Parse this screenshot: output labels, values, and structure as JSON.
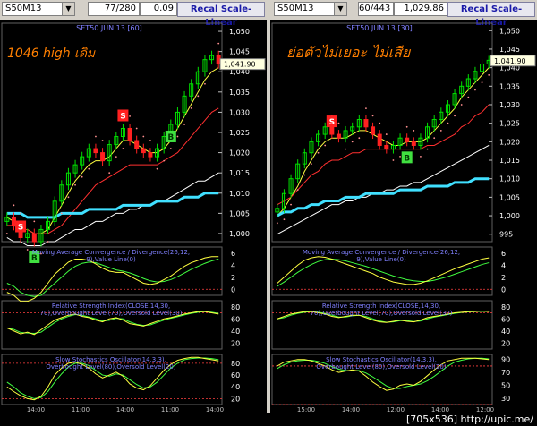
{
  "panels": [
    {
      "symbol": "S50M13",
      "counter": "77/280",
      "value_field": "0.09",
      "recal_label": "Recal Scale-Linear",
      "chart_title": "SET50 JUN 13",
      "interval": "[60]",
      "annotation": "1046 high เดิม",
      "last_price": "1,041.90",
      "price_axis": [
        "1,050",
        "1,045",
        "1,040",
        "1,035",
        "1,030",
        "1,025",
        "1,020",
        "1,015",
        "1,010",
        "1,005",
        "1,000"
      ],
      "macd_title": "Moving Average Convergence / Divergence(26,12,9),Value Line(0)",
      "macd_axis": [
        "6",
        "4",
        "2",
        "0"
      ],
      "rsi_title": "Relative Strength Index(CLOSE,14,30,70),Overbought Level(70),Oversold Level(30)",
      "rsi_axis": [
        "80",
        "60",
        "40",
        "20"
      ],
      "stoch_title": "Slow Stochastics Oscillator(14,3,3),Overbought Level(80),Oversold Level(20)",
      "stoch_axis": [
        "80",
        "60",
        "40",
        "20"
      ],
      "time_labels": [
        "14:00",
        "11:00",
        "14:00",
        "11:00",
        "14:00"
      ],
      "signals": [
        "S",
        "S",
        "B",
        "B"
      ]
    },
    {
      "symbol": "S50M13",
      "counter": "60/443",
      "value_field": "1,029.86",
      "recal_label": "Recal Scale-Linear",
      "chart_title": "SET50 JUN 13",
      "interval": "[30]",
      "annotation": "ย่อตัวไม่เยอะ ไม่เสีย",
      "last_price": "1,041.90",
      "price_axis": [
        "1,050",
        "1,045",
        "1,040",
        "1,035",
        "1,030",
        "1,025",
        "1,020",
        "1,015",
        "1,010",
        "1,005",
        "1,000",
        "995"
      ],
      "macd_title": "Moving Average Convergence / Divergence(26,12,9),Value Line(0)",
      "macd_axis": [
        "6",
        "4",
        "2",
        "0"
      ],
      "rsi_title": "Relative Strength Index(CLOSE,14,30,70),Overbought Level(70),Oversold Level(30)",
      "rsi_axis": [
        "80",
        "60",
        "40",
        "20"
      ],
      "stoch_title": "Slow Stochastics Oscillator(14,3,3),Overbought Level(80),Oversold Level(20)",
      "stoch_axis": [
        "90",
        "70",
        "50",
        "30"
      ],
      "time_labels": [
        "15:00",
        "14:00",
        "12:00",
        "14:00",
        "12:00"
      ],
      "signals": [
        "S",
        "B"
      ]
    }
  ],
  "footer": "[705x536] http://upic.me/",
  "colors": {
    "up_candle": "#00e000",
    "down_candle": "#ff2020",
    "ma_fast": "#ffff40",
    "ma_mid": "#ff3030",
    "ma_slow": "#ffffff",
    "ma_long": "#40e0ff",
    "sar": "#ff9090",
    "sell_signal": "#ff2020",
    "buy_signal": "#40e040",
    "annotation": "#ff7f00",
    "title": "#8080ff"
  },
  "chart_data": [
    {
      "type": "line",
      "title": "SET50 JUN 13 [60]",
      "ylim": [
        998,
        1052
      ],
      "y_ticks": [
        1050,
        1045,
        1040,
        1035,
        1030,
        1025,
        1020,
        1015,
        1010,
        1005,
        1000
      ],
      "last_price": 1041.9,
      "series": [
        {
          "name": "close",
          "values": [
            1004,
            1002,
            999,
            1000,
            998,
            1001,
            1003,
            1008,
            1012,
            1015,
            1017,
            1019,
            1021,
            1020,
            1018,
            1022,
            1024,
            1026,
            1023,
            1021,
            1020,
            1019,
            1021,
            1024,
            1027,
            1030,
            1034,
            1037,
            1040,
            1043,
            1044,
            1042
          ]
        },
        {
          "name": "ma_fast",
          "values": [
            1004,
            1003,
            1001,
            1001,
            1000,
            1000,
            1001,
            1004,
            1007,
            1010,
            1013,
            1015,
            1017,
            1018,
            1018,
            1019,
            1021,
            1023,
            1023,
            1022,
            1021,
            1020,
            1020,
            1021,
            1023,
            1026,
            1029,
            1032,
            1035,
            1038,
            1040,
            1041
          ]
        },
        {
          "name": "ma_mid",
          "values": [
            1002,
            1002,
            1001,
            1001,
            1000,
            1000,
            1000,
            1001,
            1002,
            1004,
            1006,
            1008,
            1010,
            1012,
            1013,
            1014,
            1015,
            1016,
            1017,
            1017,
            1017,
            1017,
            1017,
            1018,
            1019,
            1020,
            1022,
            1024,
            1026,
            1028,
            1030,
            1031
          ]
        },
        {
          "name": "ma_slow",
          "values": [
            999,
            998,
            998,
            997,
            997,
            997,
            998,
            998,
            999,
            1000,
            1001,
            1001,
            1002,
            1003,
            1003,
            1004,
            1005,
            1005,
            1006,
            1006,
            1007,
            1007,
            1008,
            1008,
            1009,
            1010,
            1011,
            1012,
            1013,
            1013,
            1014,
            1015
          ]
        },
        {
          "name": "ma_long",
          "values": [
            1005,
            1005,
            1005,
            1004,
            1004,
            1004,
            1004,
            1004,
            1005,
            1005,
            1005,
            1005,
            1006,
            1006,
            1006,
            1006,
            1006,
            1007,
            1007,
            1007,
            1007,
            1007,
            1008,
            1008,
            1008,
            1008,
            1009,
            1009,
            1009,
            1010,
            1010,
            1010
          ]
        }
      ],
      "macd": [
        -0.5,
        -1.0,
        -2.0,
        -2.0,
        -1.5,
        -0.5,
        1,
        2.5,
        3.5,
        4.5,
        5,
        5,
        4.8,
        4.2,
        3.5,
        3,
        2.8,
        2.8,
        2.2,
        1.6,
        1.0,
        0.8,
        1.0,
        1.6,
        2.2,
        3.0,
        3.8,
        4.4,
        4.8,
        5.2,
        5.4,
        5.4
      ],
      "macd_signal": [
        1,
        0.5,
        -0.5,
        -1,
        -1.2,
        -1,
        0,
        1,
        2,
        3,
        3.8,
        4.3,
        4.5,
        4.4,
        4.0,
        3.6,
        3.2,
        3.0,
        2.7,
        2.3,
        1.8,
        1.4,
        1.2,
        1.3,
        1.6,
        2.1,
        2.7,
        3.3,
        3.8,
        4.3,
        4.7,
        5.0
      ],
      "rsi": [
        45,
        40,
        35,
        38,
        34,
        42,
        50,
        58,
        62,
        66,
        68,
        64,
        62,
        58,
        55,
        60,
        62,
        58,
        52,
        50,
        48,
        52,
        56,
        60,
        62,
        65,
        68,
        70,
        72,
        72,
        70,
        68
      ],
      "rsi_ylim": [
        10,
        90
      ],
      "stoch": [
        40,
        32,
        25,
        20,
        18,
        24,
        40,
        60,
        72,
        80,
        82,
        78,
        72,
        62,
        55,
        60,
        65,
        58,
        45,
        38,
        35,
        42,
        55,
        68,
        78,
        85,
        88,
        90,
        90,
        88,
        86,
        84
      ],
      "stoch_signal": [
        48,
        40,
        30,
        24,
        20,
        22,
        32,
        48,
        62,
        74,
        80,
        80,
        76,
        68,
        60,
        58,
        62,
        60,
        52,
        44,
        38,
        40,
        48,
        60,
        72,
        80,
        86,
        88,
        89,
        89,
        88,
        86
      ],
      "stoch_ylim": [
        10,
        95
      ]
    },
    {
      "type": "line",
      "title": "SET50 JUN 13 [30]",
      "ylim": [
        993,
        1052
      ],
      "y_ticks": [
        1050,
        1045,
        1040,
        1035,
        1030,
        1025,
        1020,
        1015,
        1010,
        1005,
        1000,
        995
      ],
      "last_price": 1041.9,
      "series": [
        {
          "name": "close",
          "values": [
            1002,
            1006,
            1010,
            1014,
            1017,
            1020,
            1022,
            1024,
            1022,
            1021,
            1023,
            1024,
            1026,
            1024,
            1022,
            1019,
            1018,
            1019,
            1021,
            1020,
            1019,
            1021,
            1024,
            1026,
            1028,
            1030,
            1033,
            1035,
            1037,
            1039,
            1041,
            1042
          ]
        },
        {
          "name": "ma_fast",
          "values": [
            1000,
            1002,
            1005,
            1008,
            1012,
            1015,
            1018,
            1020,
            1021,
            1021,
            1021,
            1022,
            1023,
            1023,
            1022,
            1021,
            1020,
            1019,
            1019,
            1020,
            1020,
            1020,
            1021,
            1023,
            1025,
            1027,
            1029,
            1032,
            1034,
            1036,
            1038,
            1040
          ]
        },
        {
          "name": "ma_mid",
          "values": [
            1003,
            1004,
            1005,
            1007,
            1009,
            1011,
            1012,
            1014,
            1015,
            1015,
            1016,
            1017,
            1017,
            1018,
            1018,
            1018,
            1018,
            1018,
            1018,
            1018,
            1018,
            1018,
            1019,
            1019,
            1020,
            1021,
            1022,
            1024,
            1025,
            1027,
            1028,
            1030
          ]
        },
        {
          "name": "ma_slow",
          "values": [
            995,
            996,
            997,
            998,
            999,
            1000,
            1001,
            1002,
            1003,
            1003,
            1004,
            1004,
            1005,
            1005,
            1006,
            1006,
            1007,
            1007,
            1008,
            1008,
            1009,
            1009,
            1010,
            1011,
            1012,
            1013,
            1014,
            1015,
            1016,
            1017,
            1018,
            1019
          ]
        },
        {
          "name": "ma_long",
          "values": [
            1000,
            1001,
            1001,
            1002,
            1002,
            1003,
            1003,
            1004,
            1004,
            1004,
            1005,
            1005,
            1005,
            1006,
            1006,
            1006,
            1006,
            1006,
            1007,
            1007,
            1007,
            1007,
            1008,
            1008,
            1008,
            1008,
            1009,
            1009,
            1009,
            1010,
            1010,
            1010
          ]
        }
      ],
      "macd": [
        1,
        2,
        3,
        4,
        4.8,
        5.2,
        5.4,
        5.3,
        5,
        4.6,
        4.2,
        3.8,
        3.4,
        3.0,
        2.6,
        2.0,
        1.6,
        1.2,
        1.0,
        0.8,
        0.8,
        1.0,
        1.4,
        1.9,
        2.4,
        2.9,
        3.4,
        3.8,
        4.2,
        4.6,
        5.0,
        5.2
      ],
      "macd_signal": [
        0.5,
        1.2,
        2,
        2.8,
        3.5,
        4.1,
        4.6,
        4.9,
        5.0,
        4.9,
        4.7,
        4.4,
        4.1,
        3.8,
        3.4,
        3.0,
        2.6,
        2.2,
        1.9,
        1.6,
        1.4,
        1.3,
        1.3,
        1.5,
        1.8,
        2.1,
        2.5,
        2.9,
        3.3,
        3.7,
        4.1,
        4.4
      ],
      "rsi": [
        60,
        64,
        68,
        70,
        72,
        72,
        70,
        68,
        64,
        62,
        64,
        66,
        66,
        62,
        58,
        55,
        54,
        56,
        58,
        56,
        55,
        58,
        62,
        64,
        66,
        68,
        70,
        71,
        72,
        72,
        73,
        72
      ],
      "rsi_ylim": [
        10,
        90
      ],
      "stoch": [
        80,
        86,
        88,
        90,
        90,
        88,
        84,
        80,
        74,
        70,
        72,
        74,
        72,
        64,
        55,
        48,
        42,
        44,
        50,
        52,
        50,
        56,
        65,
        74,
        82,
        88,
        90,
        92,
        92,
        92,
        91,
        90
      ],
      "stoch_signal": [
        76,
        82,
        86,
        88,
        89,
        89,
        87,
        84,
        79,
        75,
        73,
        73,
        73,
        69,
        63,
        56,
        49,
        45,
        45,
        48,
        50,
        52,
        57,
        64,
        72,
        80,
        86,
        89,
        91,
        92,
        92,
        91
      ],
      "stoch_ylim": [
        20,
        98
      ]
    }
  ]
}
